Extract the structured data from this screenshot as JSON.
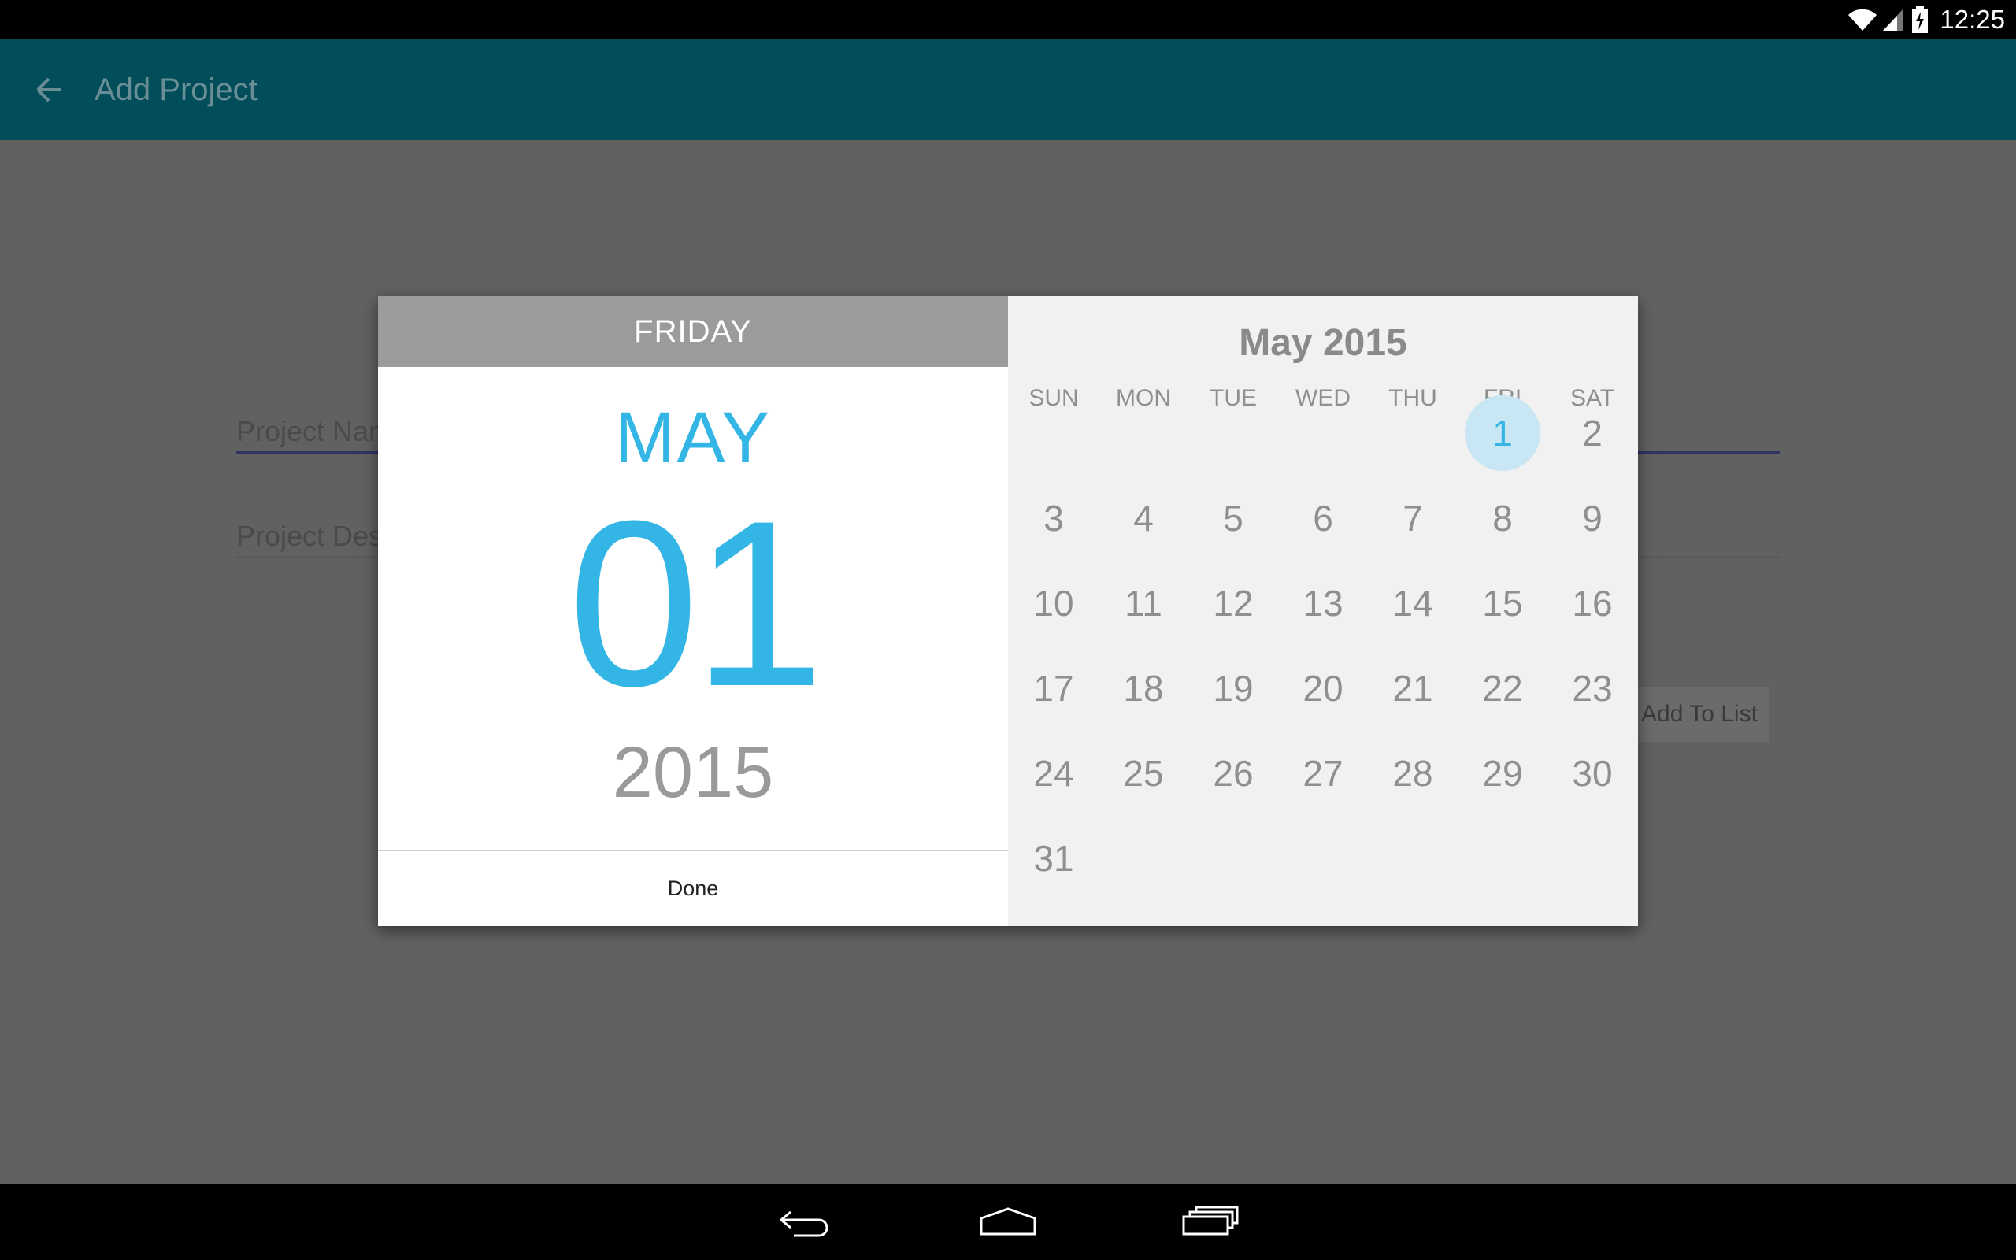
{
  "status_bar": {
    "time": "12:25",
    "icons": [
      "wifi-icon",
      "cellular-signal-icon",
      "battery-charging-icon"
    ]
  },
  "app_bar": {
    "title": "Add Project",
    "back_icon": "arrow-back-icon",
    "color": "#014d5a"
  },
  "form": {
    "name_placeholder": "Project Name",
    "description_placeholder": "Project Description",
    "add_button_label": "Add To List"
  },
  "date_picker": {
    "weekday": "FRIDAY",
    "month": "MAY",
    "day": "01",
    "year": "2015",
    "done_label": "Done",
    "month_year_title": "May 2015",
    "weekday_headers": [
      "SUN",
      "MON",
      "TUE",
      "WED",
      "THU",
      "FRI",
      "SAT"
    ],
    "first_weekday_index": 5,
    "days_in_month": 31,
    "selected_day": 1,
    "accent_color": "#33b5e5"
  },
  "nav_bar": {
    "icons": [
      "back-nav-icon",
      "home-nav-icon",
      "recents-nav-icon"
    ]
  }
}
